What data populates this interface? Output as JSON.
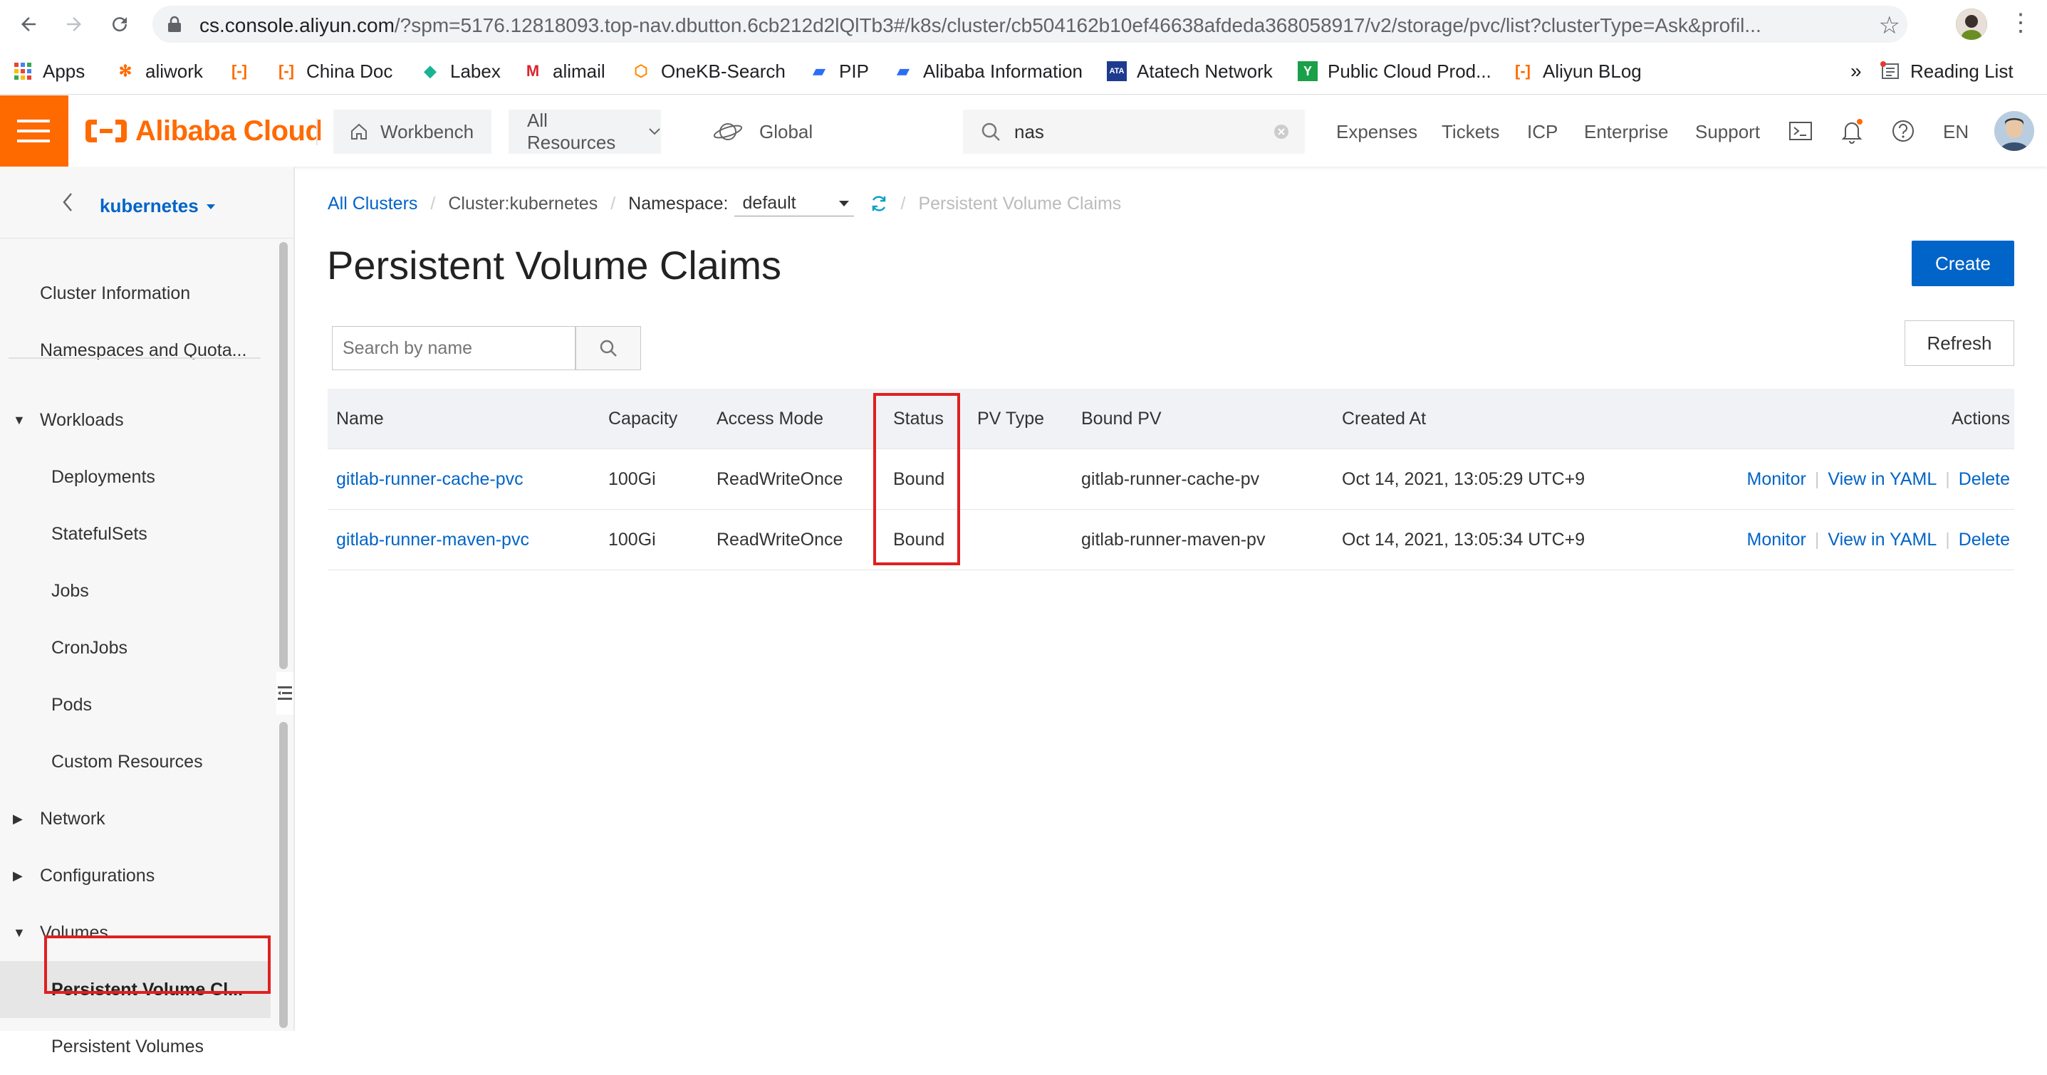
{
  "browser": {
    "url_host": "cs.console.aliyun.com",
    "url_path": "/?spm=5176.12818093.top-nav.dbutton.6cb212d2lQlTb3#/k8s/cluster/cb504162b10ef46638afdeda368058917/v2/storage/pvc/list?clusterType=Ask&profil...",
    "bookmarks": [
      {
        "label": "Apps",
        "icon": "apps-grid-icon"
      },
      {
        "label": "aliwork",
        "icon": "aliwork-icon"
      },
      {
        "label": "",
        "icon": "alibaba-cloud-icon"
      },
      {
        "label": "China Doc",
        "icon": "alibaba-cloud-icon"
      },
      {
        "label": "Labex",
        "icon": "labex-icon"
      },
      {
        "label": "alimail",
        "icon": "alimail-icon"
      },
      {
        "label": "OneKB-Search",
        "icon": "onekb-icon"
      },
      {
        "label": "PIP",
        "icon": "pip-icon"
      },
      {
        "label": "Alibaba Information",
        "icon": "alibaba-info-icon"
      },
      {
        "label": "Atatech Network",
        "icon": "ata-icon"
      },
      {
        "label": "Public Cloud Prod...",
        "icon": "public-cloud-icon"
      },
      {
        "label": "Aliyun BLog",
        "icon": "alibaba-cloud-icon"
      }
    ],
    "more_bookmarks": "»",
    "reading_list": "Reading List"
  },
  "topbar": {
    "brand": "Alibaba Cloud",
    "workbench": "Workbench",
    "all_resources": "All Resources",
    "region": "Global",
    "search_value": "nas",
    "links": [
      "Expenses",
      "Tickets",
      "ICP",
      "Enterprise",
      "Support"
    ],
    "language": "EN"
  },
  "sidebar": {
    "cluster_name": "kubernetes",
    "items": [
      {
        "label": "Cluster Information"
      },
      {
        "label": "Namespaces and Quota..."
      },
      {
        "label": "Workloads"
      },
      {
        "label": "Deployments"
      },
      {
        "label": "StatefulSets"
      },
      {
        "label": "Jobs"
      },
      {
        "label": "CronJobs"
      },
      {
        "label": "Pods"
      },
      {
        "label": "Custom Resources"
      },
      {
        "label": "Network"
      },
      {
        "label": "Configurations"
      },
      {
        "label": "Volumes"
      },
      {
        "label": "Persistent Volume Cl..."
      },
      {
        "label": "Persistent Volumes"
      }
    ]
  },
  "breadcrumb": {
    "all_clusters": "All Clusters",
    "cluster": "Cluster:kubernetes",
    "namespace_label": "Namespace:",
    "namespace_value": "default",
    "current": "Persistent Volume Claims"
  },
  "page": {
    "title": "Persistent Volume Claims",
    "create": "Create",
    "refresh": "Refresh",
    "search_placeholder": "Search by name"
  },
  "table": {
    "headers": {
      "name": "Name",
      "capacity": "Capacity",
      "access_mode": "Access Mode",
      "status": "Status",
      "pv_type": "PV Type",
      "bound_pv": "Bound PV",
      "created_at": "Created At",
      "actions": "Actions"
    },
    "rows": [
      {
        "name": "gitlab-runner-cache-pvc",
        "capacity": "100Gi",
        "access_mode": "ReadWriteOnce",
        "status": "Bound",
        "pv_type": "",
        "bound_pv": "gitlab-runner-cache-pv",
        "created_at": "Oct 14, 2021, 13:05:29 UTC+9",
        "actions": [
          "Monitor",
          "View in YAML",
          "Delete"
        ]
      },
      {
        "name": "gitlab-runner-maven-pvc",
        "capacity": "100Gi",
        "access_mode": "ReadWriteOnce",
        "status": "Bound",
        "pv_type": "",
        "bound_pv": "gitlab-runner-maven-pv",
        "created_at": "Oct 14, 2021, 13:05:34 UTC+9",
        "actions": [
          "Monitor",
          "View in YAML",
          "Delete"
        ]
      }
    ]
  },
  "colors": {
    "brand_orange": "#ff6a00",
    "primary_blue": "#0064c8",
    "highlight_red": "#e02020"
  }
}
